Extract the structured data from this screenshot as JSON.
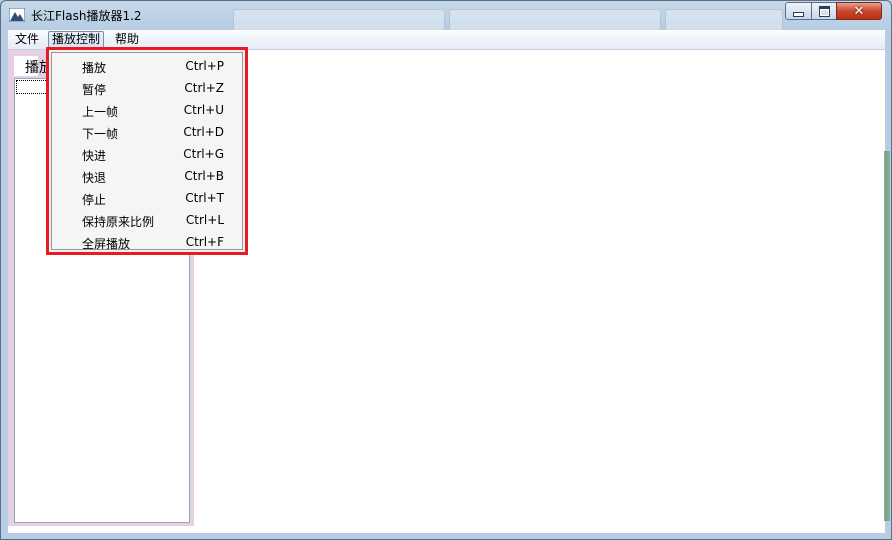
{
  "window": {
    "title": "长江Flash播放器1.2",
    "buttons": {
      "minimize": "minimize",
      "maximize": "maximize",
      "close": "close"
    }
  },
  "menubar": {
    "items": [
      {
        "label": "文件"
      },
      {
        "label": "播放控制"
      },
      {
        "label": "帮助"
      }
    ]
  },
  "left_panel": {
    "tab_label": "播放"
  },
  "play_menu": {
    "items": [
      {
        "label": "播放",
        "shortcut": "Ctrl+P"
      },
      {
        "label": "暂停",
        "shortcut": "Ctrl+Z"
      },
      {
        "label": "上一帧",
        "shortcut": "Ctrl+U"
      },
      {
        "label": "下一帧",
        "shortcut": "Ctrl+D"
      },
      {
        "label": "快进",
        "shortcut": "Ctrl+G"
      },
      {
        "label": "快退",
        "shortcut": "Ctrl+B"
      },
      {
        "label": "停止",
        "shortcut": "Ctrl+T"
      },
      {
        "label": "保持原来比例",
        "shortcut": "Ctrl+L"
      },
      {
        "label": "全屏播放",
        "shortcut": "Ctrl+F"
      }
    ]
  },
  "colors": {
    "highlight_border": "#e81a22",
    "panel_bg": "#e4cfe3"
  }
}
